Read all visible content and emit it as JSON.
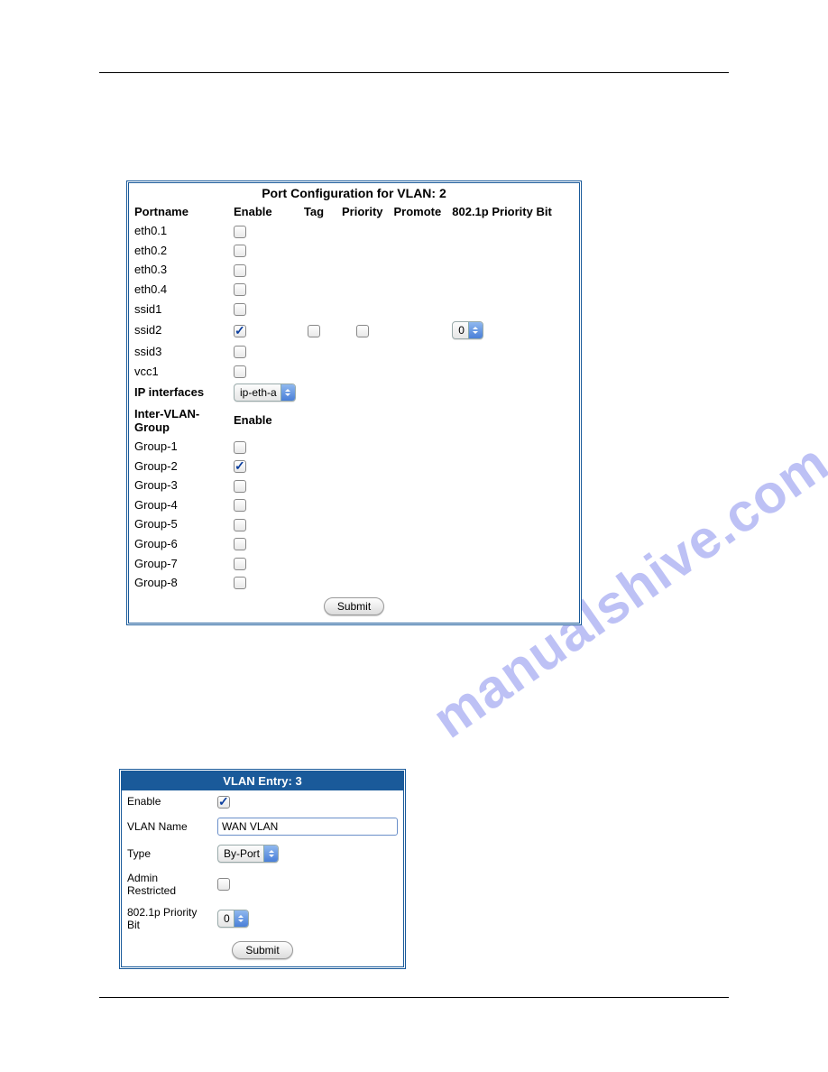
{
  "watermark_text": "manualshive.com",
  "panel1": {
    "title": "Port Configuration for VLAN: 2",
    "headers": {
      "portname": "Portname",
      "enable": "Enable",
      "tag": "Tag",
      "priority": "Priority",
      "promote": "Promote",
      "pbit": "802.1p Priority Bit"
    },
    "ports": [
      {
        "name": "eth0.1",
        "enabled": false
      },
      {
        "name": "eth0.2",
        "enabled": false
      },
      {
        "name": "eth0.3",
        "enabled": false
      },
      {
        "name": "eth0.4",
        "enabled": false
      },
      {
        "name": "ssid1",
        "enabled": false
      },
      {
        "name": "ssid2",
        "enabled": true,
        "tag": false,
        "priority": false,
        "pbit_value": "0"
      },
      {
        "name": "ssid3",
        "enabled": false
      },
      {
        "name": "vcc1",
        "enabled": false
      }
    ],
    "ip_interfaces_label": "IP interfaces",
    "ip_interfaces_value": "ip-eth-a",
    "inter_vlan_group_label": "Inter-VLAN-Group",
    "inter_vlan_enable_header": "Enable",
    "groups": [
      {
        "name": "Group-1",
        "enabled": false
      },
      {
        "name": "Group-2",
        "enabled": true
      },
      {
        "name": "Group-3",
        "enabled": false
      },
      {
        "name": "Group-4",
        "enabled": false
      },
      {
        "name": "Group-5",
        "enabled": false
      },
      {
        "name": "Group-6",
        "enabled": false
      },
      {
        "name": "Group-7",
        "enabled": false
      },
      {
        "name": "Group-8",
        "enabled": false
      }
    ],
    "submit_label": "Submit"
  },
  "panel2": {
    "title": "VLAN Entry: 3",
    "rows": {
      "enable_label": "Enable",
      "enable_checked": true,
      "vlan_name_label": "VLAN Name",
      "vlan_name_value": "WAN VLAN",
      "type_label": "Type",
      "type_value": "By-Port",
      "admin_restricted_label": "Admin Restricted",
      "admin_restricted_checked": false,
      "pbit_label": "802.1p Priority Bit",
      "pbit_value": "0"
    },
    "submit_label": "Submit"
  }
}
